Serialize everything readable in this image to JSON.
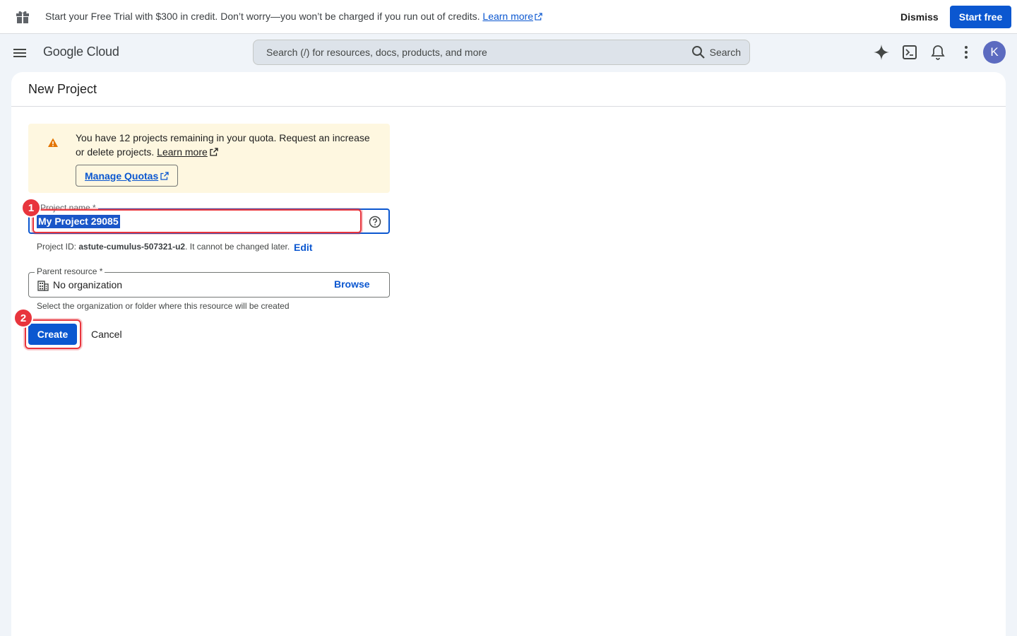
{
  "promo": {
    "text": "Start your Free Trial with $300 in credit. Don’t worry—you won’t be charged if you run out of credits.",
    "learn_more": "Learn more",
    "dismiss": "Dismiss",
    "start_free": "Start free"
  },
  "topbar": {
    "brand": "Google Cloud",
    "search_placeholder": "Search (/) for resources, docs, products, and more",
    "search_button": "Search",
    "avatar_letter": "K"
  },
  "page": {
    "title": "New Project"
  },
  "quota": {
    "message": "You have 12 projects remaining in your quota. Request an increase or delete projects.",
    "learn_more": "Learn more",
    "manage_quotas": "Manage Quotas"
  },
  "form": {
    "project_name_label": "Project name *",
    "project_name_value": "My Project 29085",
    "project_id_prefix": "Project ID:",
    "project_id_value": "astute-cumulus-507321-u2",
    "project_id_suffix": ". It cannot be changed later.",
    "edit": "Edit",
    "parent_label": "Parent resource *",
    "parent_value": "No organization",
    "browse": "Browse",
    "parent_hint": "Select the organization or folder where this resource will be created",
    "create": "Create",
    "cancel": "Cancel"
  },
  "annotations": {
    "badge1": "1",
    "badge2": "2"
  },
  "colors": {
    "primary": "#0b57d0",
    "annotation_red": "#e8353d",
    "warning_bg": "#fef7e0",
    "warning_icon": "#e37400"
  }
}
